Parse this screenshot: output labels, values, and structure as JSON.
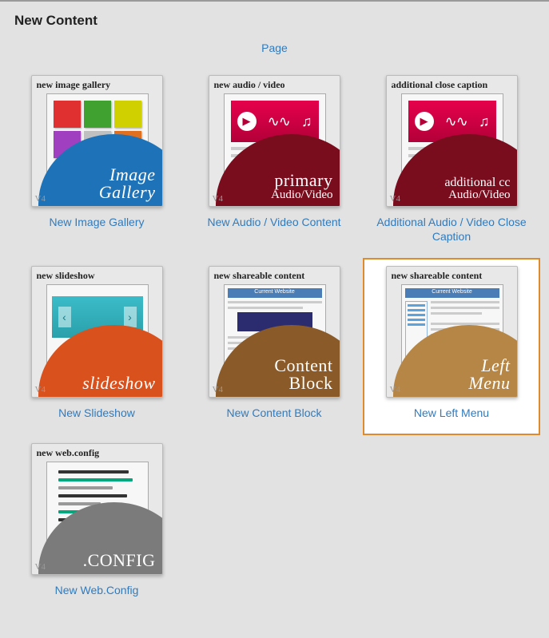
{
  "header": {
    "title": "New Content"
  },
  "top_link": "Page",
  "version_tag": "V4",
  "tiles": {
    "gallery": {
      "title": "new image gallery",
      "blob_big": "Image",
      "blob_small": "Gallery",
      "caption": "New Image Gallery"
    },
    "av": {
      "title": "new audio / video",
      "blob_big": "primary",
      "blob_small": "Audio/Video",
      "caption": "New Audio / Video Content"
    },
    "cc": {
      "title": "additional close caption",
      "blob_big": "additional cc",
      "blob_small": "Audio/Video",
      "caption": "Additional Audio / Video Close Caption"
    },
    "slideshow": {
      "title": "new slideshow",
      "blob_big": "slideshow",
      "blob_small": "",
      "caption": "New Slideshow"
    },
    "cblock": {
      "title": "new shareable content",
      "blob_big": "Content",
      "blob_small": "Block",
      "caption": "New Content Block"
    },
    "leftmenu": {
      "title": "new shareable content",
      "blob_big": "Left",
      "blob_small": "Menu",
      "caption": "New Left Menu",
      "inner_label": "Current Website"
    },
    "config": {
      "title": "new web.config",
      "blob_big": ".CONFIG",
      "blob_small": "",
      "caption": "New Web.Config"
    }
  }
}
